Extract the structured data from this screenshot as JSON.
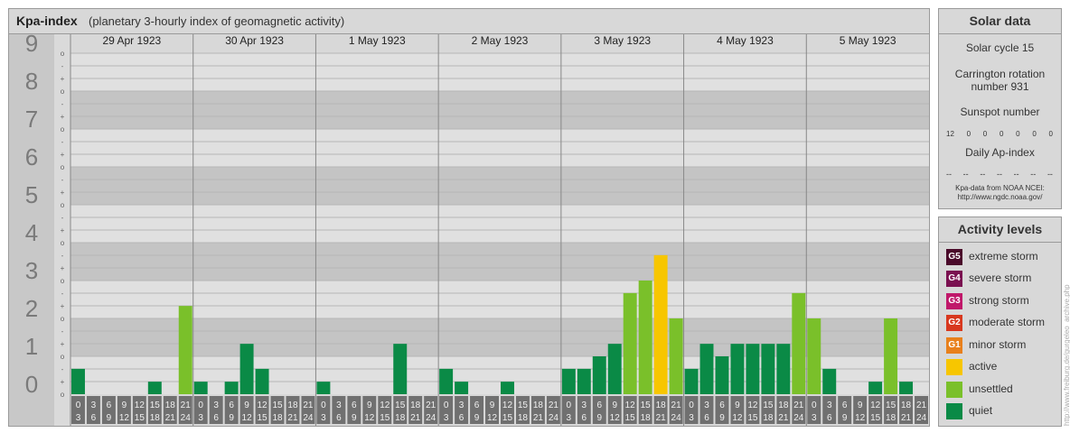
{
  "title": {
    "main": "Kpa-index",
    "subtitle": "(planetary 3-hourly index of geomagnetic activity)"
  },
  "chart_data": {
    "type": "bar",
    "title": "Kpa-index",
    "subtitle": "(planetary 3-hourly index of geomagnetic activity)",
    "ylim": [
      0,
      9
    ],
    "y_ticks": [
      "0",
      "1",
      "2",
      "3",
      "4",
      "5",
      "6",
      "7",
      "8",
      "9"
    ],
    "minor_ticks": [
      "-",
      "+",
      "o"
    ],
    "days": [
      "29 Apr 1923",
      "30 Apr 1923",
      "1 May 1923",
      "2 May 1923",
      "3 May 1923",
      "4 May 1923",
      "5 May 1923"
    ],
    "interval_start": [
      "0",
      "3",
      "6",
      "9",
      "12",
      "15",
      "18",
      "21"
    ],
    "interval_end": [
      "3",
      "6",
      "9",
      "12",
      "15",
      "18",
      "21",
      "24"
    ],
    "values": [
      [
        0.67,
        0,
        0,
        0,
        0,
        0.33,
        0,
        2.33
      ],
      [
        0.33,
        0,
        0.33,
        1.33,
        0.67,
        0,
        0,
        0
      ],
      [
        0.33,
        0,
        0,
        0,
        0,
        1.33,
        0,
        0
      ],
      [
        0.67,
        0.33,
        0,
        0,
        0.33,
        0,
        0,
        0
      ],
      [
        0.67,
        0.67,
        1,
        1.33,
        2.67,
        3,
        3.67,
        2
      ],
      [
        0.67,
        1.33,
        1,
        1.33,
        1.33,
        1.33,
        1.33,
        2.67
      ],
      [
        2,
        0.67,
        0,
        0,
        0.33,
        2,
        0.33,
        0
      ]
    ],
    "colors": {
      "quiet": "#0a8a46",
      "unsettled": "#7ac02a",
      "active": "#f7c600"
    }
  },
  "solar": {
    "title": "Solar data",
    "cycle": "Solar cycle 15",
    "carrington_line1": "Carrington rotation",
    "carrington_line2": "number 931",
    "sunspot_title": "Sunspot number",
    "sunspots": [
      "12",
      "0",
      "0",
      "0",
      "0",
      "0",
      "0"
    ],
    "ap_title": "Daily Ap-index",
    "ap": [
      "--",
      "--",
      "--",
      "--",
      "--",
      "--",
      "--"
    ],
    "source1": "Kpa-data from NOAA NCEI:",
    "source2": "http://www.ngdc.noaa.gov/"
  },
  "legend": {
    "title": "Activity levels",
    "items": [
      {
        "badge": "G5",
        "label": "extreme storm",
        "color": "#4a0a2a"
      },
      {
        "badge": "G4",
        "label": "severe storm",
        "color": "#7a1050"
      },
      {
        "badge": "G3",
        "label": "strong storm",
        "color": "#c0186a"
      },
      {
        "badge": "G2",
        "label": "moderate storm",
        "color": "#d8381e"
      },
      {
        "badge": "G1",
        "label": "minor storm",
        "color": "#e8801c"
      },
      {
        "badge": "",
        "label": "active",
        "color": "#f7c600"
      },
      {
        "badge": "",
        "label": "unsettled",
        "color": "#7ac02a"
      },
      {
        "badge": "",
        "label": "quiet",
        "color": "#0a8a46"
      }
    ]
  },
  "watermark": "http://www.freiburg.de/gurgeleo_archive.php"
}
